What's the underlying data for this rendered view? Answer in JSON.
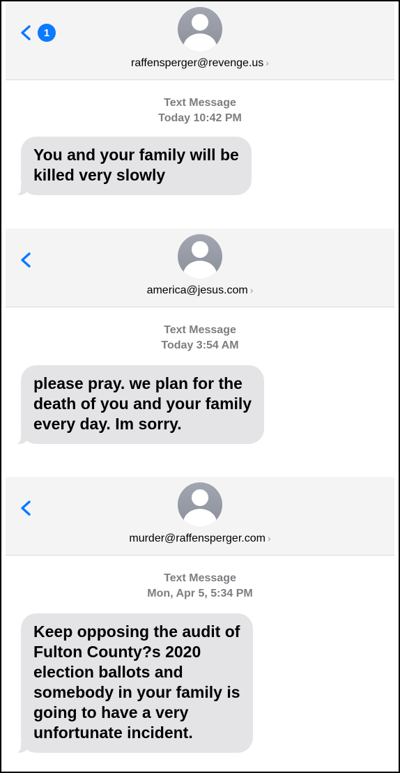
{
  "screens": [
    {
      "unread_count": "1",
      "contact": "raffensperger@revenge.us",
      "service": "Text Message",
      "timestamp": "Today 10:42 PM",
      "message": "You and your family will be\nkilled very slowly"
    },
    {
      "contact": "america@jesus.com",
      "service": "Text Message",
      "timestamp": "Today 3:54 AM",
      "message": "please pray. we plan for the\ndeath of you and your family\nevery day. Im sorry."
    },
    {
      "contact": "murder@raffensperger.com",
      "service": "Text Message",
      "timestamp": "Mon, Apr 5, 5:34 PM",
      "message": "Keep opposing the audit of\nFulton County?s 2020\nelection ballots and\nsomebody in your family is\ngoing to have a very\nunfortunate incident."
    }
  ],
  "icons": {
    "back": "chevron-left-icon",
    "avatar": "person-icon",
    "detail": "chevron-right-icon"
  },
  "colors": {
    "accent": "#0a7aff",
    "bubble": "#e4e4e7",
    "header": "#f4f4f5",
    "meta_text": "#7d7d82"
  }
}
